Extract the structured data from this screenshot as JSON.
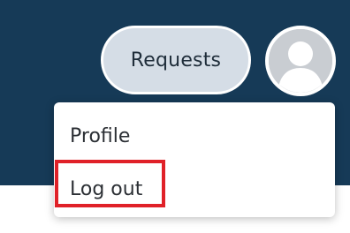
{
  "header": {
    "requests_label": "Requests",
    "avatar_icon": "user-avatar-icon",
    "background_color": "#163a57"
  },
  "dropdown": {
    "items": [
      {
        "label": "Profile"
      },
      {
        "label": "Log out"
      }
    ],
    "highlight_color": "#e02128"
  }
}
